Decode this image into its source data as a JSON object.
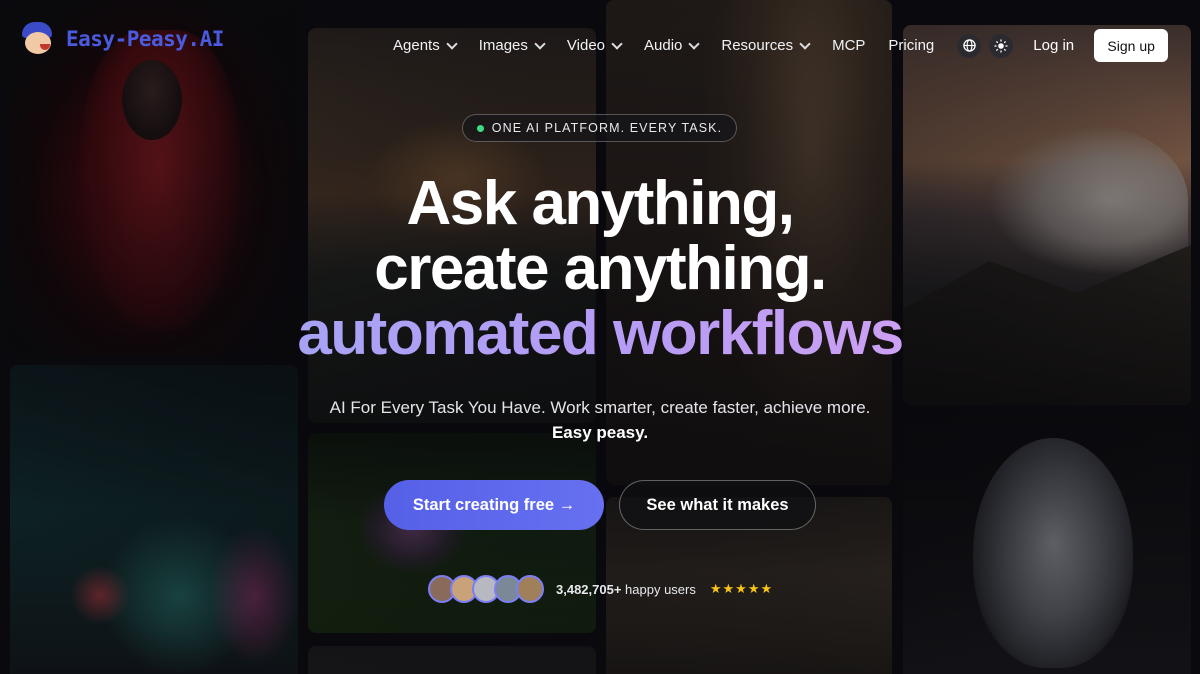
{
  "brand": {
    "name": "Easy-Peasy.AI"
  },
  "nav": {
    "items": [
      {
        "label": "Agents",
        "dropdown": true
      },
      {
        "label": "Images",
        "dropdown": true
      },
      {
        "label": "Video",
        "dropdown": true
      },
      {
        "label": "Audio",
        "dropdown": true
      },
      {
        "label": "Resources",
        "dropdown": true
      },
      {
        "label": "MCP",
        "dropdown": false
      },
      {
        "label": "Pricing",
        "dropdown": false
      }
    ],
    "icons": [
      "globe-icon",
      "sun-icon"
    ],
    "login": "Log in",
    "signup": "Sign up"
  },
  "hero": {
    "badge": "ONE AI PLATFORM. EVERY TASK.",
    "line1": "Ask anything,",
    "line2": "create anything.",
    "line3": "automated workflows",
    "subtitle": "AI For Every Task You Have. Work smarter, create faster, achieve more.",
    "subtitle_bold": "Easy peasy.",
    "cta_primary": "Start creating free →",
    "cta_secondary": "See what it makes",
    "user_count": "3,482,705+",
    "user_suffix": " happy users",
    "rating": "★★★★★"
  },
  "colors": {
    "accent": "#5b66ec",
    "brand": "#4b5be0",
    "gradient_start": "#9aa8f5",
    "gradient_end": "#e6a6f0",
    "star": "#f5c518",
    "status_dot": "#3ddc84"
  },
  "avatars": [
    {
      "color": "#8a6a5a"
    },
    {
      "color": "#c9a27a"
    },
    {
      "color": "#b8b8c0"
    },
    {
      "color": "#7a8898"
    },
    {
      "color": "#a0805a"
    }
  ]
}
